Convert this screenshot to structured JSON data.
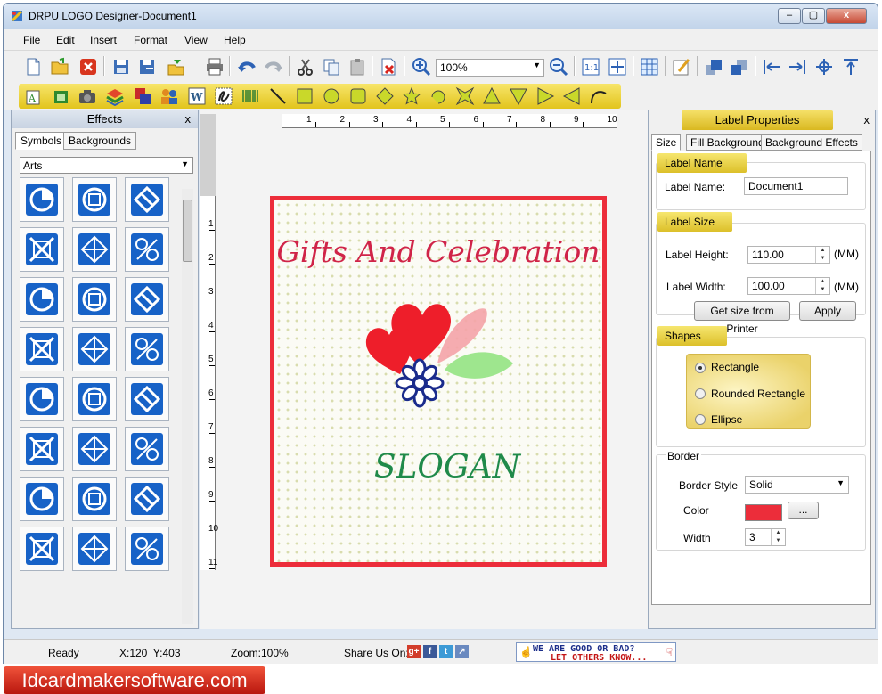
{
  "window": {
    "title": "DRPU LOGO Designer-Document1",
    "controls": {
      "minimize": "–",
      "maximize": "▢",
      "close": "x"
    }
  },
  "menu": [
    "File",
    "Edit",
    "Insert",
    "Format",
    "View",
    "Help"
  ],
  "toolbar": {
    "zoom_value": "100%"
  },
  "effects_panel": {
    "title": "Effects",
    "close": "x",
    "tabs": [
      "Symbols",
      "Backgrounds"
    ],
    "category": "Arts"
  },
  "canvas": {
    "ruler_h": [
      "1",
      "2",
      "3",
      "4",
      "5",
      "6",
      "7",
      "8",
      "9",
      "10"
    ],
    "ruler_v": [
      "1",
      "2",
      "3",
      "4",
      "5",
      "6",
      "7",
      "8",
      "9",
      "10",
      "11"
    ],
    "logo_title": "Gifts And Celebration",
    "logo_slogan": "SLOGAN",
    "border_color": "#ec2d3a"
  },
  "label_properties": {
    "title": "Label Properties",
    "close": "x",
    "tabs": [
      "Size",
      "Fill Background",
      "Background Effects"
    ],
    "label_name_section": "Label Name",
    "label_name_caption": "Label Name:",
    "label_name_value": "Document1",
    "label_size_section": "Label Size",
    "height_caption": "Label Height:",
    "height_value": "110.00",
    "width_caption": "Label Width:",
    "width_value": "100.00",
    "unit": "(MM)",
    "get_size_button": "Get size from Printer",
    "apply_button": "Apply",
    "shapes_section": "Shapes",
    "shapes": [
      "Rectangle",
      "Rounded Rectangle",
      "Ellipse"
    ],
    "selected_shape": "Rectangle",
    "border_section": "Border",
    "border_style_caption": "Border Style",
    "border_style_value": "Solid",
    "color_caption": "Color",
    "color_value": "#ec2d3a",
    "color_button": "...",
    "width_caption_border": "Width",
    "border_width_value": "3"
  },
  "status": {
    "state": "Ready",
    "coords": "X:120  Y:403",
    "zoom": "Zoom:100%",
    "share": "Share Us On:",
    "feedback_line1": "WE ARE GOOD OR BAD?",
    "feedback_line2": "LET OTHERS KNOW..."
  },
  "watermark": "Idcardmakersoftware.com"
}
